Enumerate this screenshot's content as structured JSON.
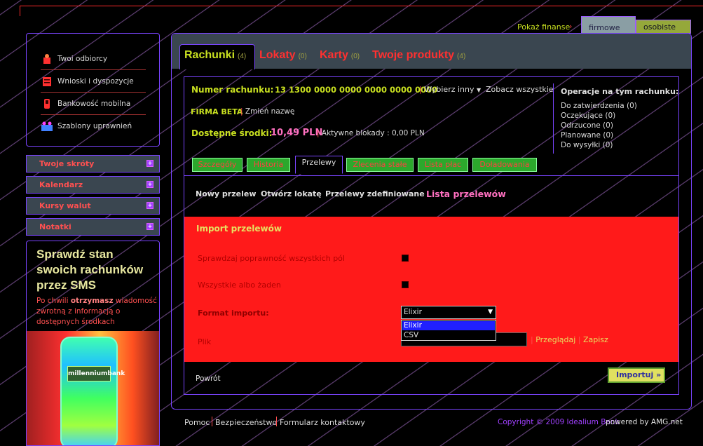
{
  "top": {
    "show_finance": "Pokaż finanse",
    "tab_company": "firmowe",
    "tab_personal": "osobiste"
  },
  "sidebar": {
    "items": [
      {
        "label": "Twoi odbiorcy",
        "icon": "recipients-icon"
      },
      {
        "label": "Wnioski i dyspozycje",
        "icon": "requests-icon"
      },
      {
        "label": "Bankowość mobilna",
        "icon": "mobile-icon"
      },
      {
        "label": "Szablony uprawnień",
        "icon": "permissions-icon"
      }
    ],
    "accordion": [
      "Twoje skróty",
      "Kalendarz",
      "Kursy walut",
      "Notatki"
    ]
  },
  "promo": {
    "title": "Sprawdź stan swoich rachunków przez SMS",
    "text_pre": "Po chwili ",
    "text_bold": "otrzymasz",
    "text_post": " wiadomość zwrotną z informacją o dostępnych środkach",
    "phone_screen": "millenniumbank"
  },
  "main_tabs": [
    {
      "label": "Rachunki",
      "count": "(4)",
      "color": "#c8e020"
    },
    {
      "label": "Lokaty",
      "count": "(0)",
      "color": "#ff3030"
    },
    {
      "label": "Karty",
      "count": "(0)",
      "color": "#ff3030"
    },
    {
      "label": "Twoje produkty",
      "count": "(4)",
      "color": "#ff3030"
    }
  ],
  "account": {
    "number_label": "Numer rachunku:",
    "number": "13 1300 0000 0000 0000 0000 0000",
    "choose_other": "Wybierz inny",
    "see_all": "Zobacz wszystkie",
    "company": "FIRMA BETA",
    "rename": "Zmień nazwę",
    "available_label": "Dostępne środki:",
    "available": "10,49 PLN",
    "blocks": "Aktywne blokady :   0,00 PLN"
  },
  "operations": {
    "title": "Operacje na tym rachunku:",
    "items": [
      "Do zatwierdzenia (0)",
      "Oczekujące (0)",
      "Odrzucone (0)",
      "Planowane (0)",
      "Do wysyłki (0)"
    ]
  },
  "subtabs": [
    "Szczegóły",
    "Historia",
    "Przelewy",
    "Zlecenia stałe",
    "Lista płac",
    "Doładowania"
  ],
  "transfer_links": [
    "Nowy przelew",
    "Otwórz lokatę",
    "Przelewy zdefiniowane",
    "Lista przelewów"
  ],
  "import": {
    "title": "Import przelewów",
    "check_all": "Sprawdzaj poprawność wszystkich pól",
    "all_or_none": "Wszystkie albo żaden",
    "format_label": "Format importu:",
    "format_value": "Elixir",
    "format_options": [
      "Elixir",
      "CSV"
    ],
    "file_label": "Plik",
    "browse": "Przeglądaj",
    "save": "Zapisz",
    "back": "Powrót",
    "import_button": "Importuj  »"
  },
  "footer": {
    "links": [
      "Pomoc",
      "Bezpieczeństwo",
      "Formularz kontaktowy"
    ],
    "copyright": "Copyright © 2009 Idealium Bank",
    "powered": "powered by AMG.net"
  }
}
